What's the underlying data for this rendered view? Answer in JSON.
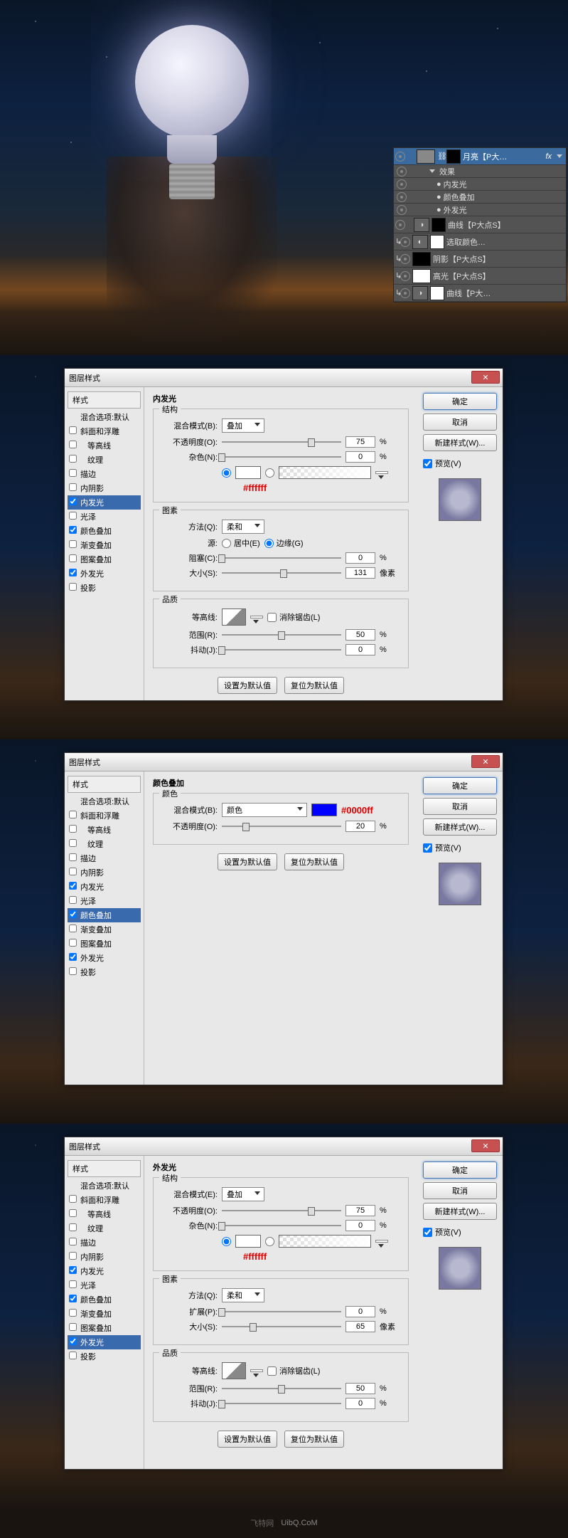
{
  "layers_panel": {
    "rows": [
      {
        "type": "layer",
        "selected": true,
        "name": "月亮【P大…",
        "fx": "fx"
      },
      {
        "type": "effect",
        "name": "效果"
      },
      {
        "type": "effect",
        "name": "内发光"
      },
      {
        "type": "effect",
        "name": "颜色叠加"
      },
      {
        "type": "effect",
        "name": "外发光"
      },
      {
        "type": "adj",
        "name": "曲线【P大点S】"
      },
      {
        "type": "adj",
        "name": "选取颜色…"
      },
      {
        "type": "layer",
        "name": "阴影【P大点S】"
      },
      {
        "type": "layer",
        "name": "高光【P大点S】"
      },
      {
        "type": "adj",
        "name": "曲线【P大…"
      }
    ]
  },
  "dialog1": {
    "title": "图层样式",
    "styles_header": "样式",
    "blend_options": "混合选项:默认",
    "style_items": [
      {
        "label": "斜面和浮雕",
        "checked": false
      },
      {
        "label": "等高线",
        "checked": false,
        "indent": true
      },
      {
        "label": "纹理",
        "checked": false,
        "indent": true
      },
      {
        "label": "描边",
        "checked": false
      },
      {
        "label": "内阴影",
        "checked": false
      },
      {
        "label": "内发光",
        "checked": true,
        "selected": true
      },
      {
        "label": "光泽",
        "checked": false
      },
      {
        "label": "颜色叠加",
        "checked": true
      },
      {
        "label": "渐变叠加",
        "checked": false
      },
      {
        "label": "图案叠加",
        "checked": false
      },
      {
        "label": "外发光",
        "checked": true
      },
      {
        "label": "投影",
        "checked": false
      }
    ],
    "section_title": "内发光",
    "struct_label": "结构",
    "blend_mode_label": "混合模式(B):",
    "blend_mode_value": "叠加",
    "opacity_label": "不透明度(O):",
    "opacity_value": "75",
    "pct": "%",
    "noise_label": "杂色(N):",
    "noise_value": "0",
    "color_annot": "#ffffff",
    "elements_label": "图素",
    "technique_label": "方法(Q):",
    "technique_value": "柔和",
    "source_label": "源:",
    "source_center": "居中(E)",
    "source_edge": "边缘(G)",
    "choke_label": "阻塞(C):",
    "choke_value": "0",
    "size_label": "大小(S):",
    "size_value": "131",
    "px": "像素",
    "quality_label": "品质",
    "contour_label": "等高线:",
    "antialias_label": "消除锯齿(L)",
    "range_label": "范围(R):",
    "range_value": "50",
    "jitter_label": "抖动(J):",
    "jitter_value": "0",
    "set_default": "设置为默认值",
    "reset_default": "复位为默认值",
    "btn_ok": "确定",
    "btn_cancel": "取消",
    "btn_new_style": "新建样式(W)...",
    "preview_label": "预览(V)"
  },
  "dialog2": {
    "title": "图层样式",
    "style_items": [
      {
        "label": "斜面和浮雕",
        "checked": false
      },
      {
        "label": "等高线",
        "checked": false,
        "indent": true
      },
      {
        "label": "纹理",
        "checked": false,
        "indent": true
      },
      {
        "label": "描边",
        "checked": false
      },
      {
        "label": "内阴影",
        "checked": false
      },
      {
        "label": "内发光",
        "checked": true
      },
      {
        "label": "光泽",
        "checked": false
      },
      {
        "label": "颜色叠加",
        "checked": true,
        "selected": true
      },
      {
        "label": "渐变叠加",
        "checked": false
      },
      {
        "label": "图案叠加",
        "checked": false
      },
      {
        "label": "外发光",
        "checked": true
      },
      {
        "label": "投影",
        "checked": false
      }
    ],
    "section_title": "颜色叠加",
    "color_label": "颜色",
    "blend_mode_label": "混合模式(B):",
    "blend_mode_value": "颜色",
    "color_swatch": "#0000ff",
    "color_annot": "#0000ff",
    "opacity_label": "不透明度(O):",
    "opacity_value": "20",
    "pct": "%"
  },
  "dialog3": {
    "title": "图层样式",
    "style_items": [
      {
        "label": "斜面和浮雕",
        "checked": false
      },
      {
        "label": "等高线",
        "checked": false,
        "indent": true
      },
      {
        "label": "纹理",
        "checked": false,
        "indent": true
      },
      {
        "label": "描边",
        "checked": false
      },
      {
        "label": "内阴影",
        "checked": false
      },
      {
        "label": "内发光",
        "checked": true
      },
      {
        "label": "光泽",
        "checked": false
      },
      {
        "label": "颜色叠加",
        "checked": true
      },
      {
        "label": "渐变叠加",
        "checked": false
      },
      {
        "label": "图案叠加",
        "checked": false
      },
      {
        "label": "外发光",
        "checked": true,
        "selected": true
      },
      {
        "label": "投影",
        "checked": false
      }
    ],
    "section_title": "外发光",
    "struct_label": "结构",
    "blend_mode_label": "混合模式(E):",
    "blend_mode_value": "叠加",
    "opacity_label": "不透明度(O):",
    "opacity_value": "75",
    "pct": "%",
    "noise_label": "杂色(N):",
    "noise_value": "0",
    "color_annot": "#ffffff",
    "elements_label": "图素",
    "technique_label": "方法(Q):",
    "technique_value": "柔和",
    "spread_label": "扩展(P):",
    "spread_value": "0",
    "size_label": "大小(S):",
    "size_value": "65",
    "px": "像素",
    "quality_label": "品质",
    "contour_label": "等高线:",
    "antialias_label": "消除锯齿(L)",
    "range_label": "范围(R):",
    "range_value": "50",
    "jitter_label": "抖动(J):",
    "jitter_value": "0"
  },
  "watermark": "飞特网",
  "watermark_url": "UibQ.CoM"
}
